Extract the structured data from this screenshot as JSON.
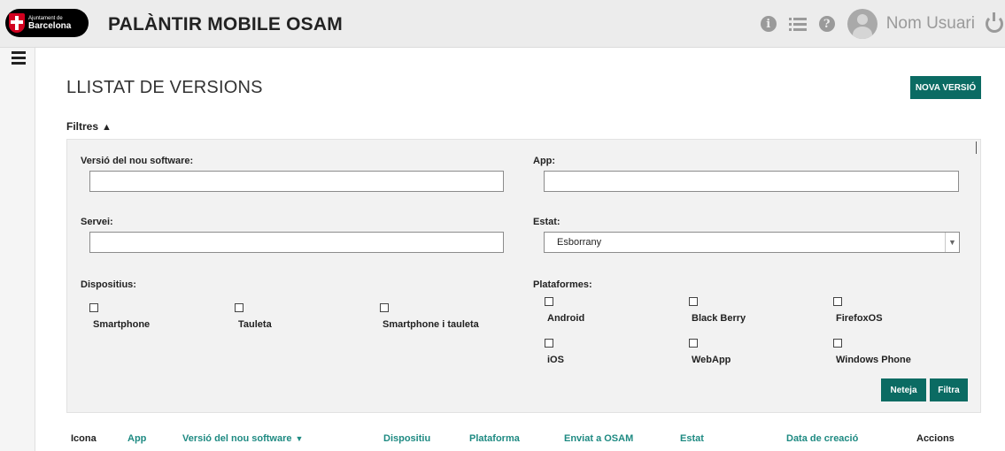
{
  "header": {
    "logo_small": "Ajuntament de",
    "logo_big": "Barcelona",
    "app_title": "PALÀNTIR MOBILE OSAM",
    "user_name": "Nom Usuari",
    "icons": [
      "info-icon",
      "list-icon",
      "help-icon",
      "user-avatar-icon",
      "power-icon"
    ]
  },
  "page": {
    "title": "LLISTAT DE VERSIONS",
    "new_button": "NOVA VERSIÓ",
    "filters_label": "Filtres",
    "filters_state_icon": "chevron-up-icon"
  },
  "filters": {
    "version_label": "Versió del nou software:",
    "version_value": "",
    "app_label": "App:",
    "app_value": "",
    "service_label": "Servei:",
    "service_value": "",
    "state_label": "Estat:",
    "state_value": "Esborrany",
    "devices_label": "Dispositius:",
    "devices": [
      {
        "label": "Smartphone",
        "checked": false
      },
      {
        "label": "Tauleta",
        "checked": false
      },
      {
        "label": "Smartphone i tauleta",
        "checked": false
      }
    ],
    "platforms_label": "Plataformes:",
    "platforms": [
      {
        "label": "Android",
        "checked": false
      },
      {
        "label": "Black Berry",
        "checked": false
      },
      {
        "label": "FirefoxOS",
        "checked": false
      },
      {
        "label": "iOS",
        "checked": false
      },
      {
        "label": "WebApp",
        "checked": false
      },
      {
        "label": "Windows Phone",
        "checked": false
      }
    ],
    "clear_button": "Neteja",
    "filter_button": "Filtra"
  },
  "table": {
    "columns": [
      "Icona",
      "App",
      "Versió del nou software",
      "Dispositiu",
      "Plataforma",
      "Enviat a OSAM",
      "Estat",
      "Data de creació",
      "Accions"
    ]
  },
  "colors": {
    "accent": "#0b6b63",
    "link": "#1e8a82",
    "header_bg": "#ececec",
    "panel_bg": "#f2f2f2"
  }
}
